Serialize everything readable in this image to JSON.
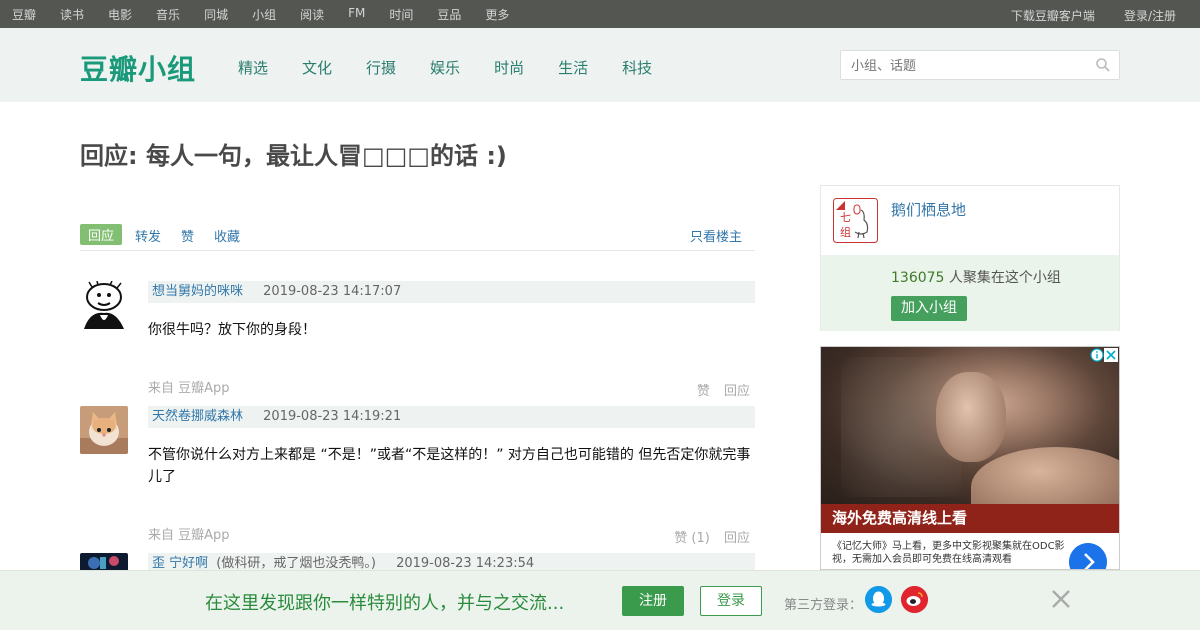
{
  "global_nav": {
    "links": [
      "豆瓣",
      "读书",
      "电影",
      "音乐",
      "同城",
      "小组",
      "阅读",
      "FM",
      "时间",
      "豆品",
      "更多"
    ],
    "download": "下载豆瓣客户端",
    "login": "登录/注册"
  },
  "group_header": {
    "logo": "豆瓣小组",
    "categories": [
      "精选",
      "文化",
      "行摄",
      "娱乐",
      "时尚",
      "生活",
      "科技"
    ],
    "search_placeholder": "小组、话题"
  },
  "topic": {
    "title": "回应: 每人一句，最让人冒□□□的话 :)"
  },
  "actions": {
    "reply": "回应",
    "forward": "转发",
    "like": "赞",
    "collect": "收藏",
    "only_op": "只看楼主"
  },
  "comments": [
    {
      "author": "想当舅妈的咪咪",
      "time": "2019-08-23 14:17:07",
      "content": "你很牛吗？放下你的身段！",
      "source": "来自 豆瓣App",
      "like": "赞",
      "reply": "回应"
    },
    {
      "author": "天然卷挪威森林",
      "time": "2019-08-23 14:19:21",
      "content": "不管你说什么对方上来都是 “不是！”或者“不是这样的！” 对方自己也可能错的 但先否定你就完事儿了",
      "source": "来自 豆瓣App",
      "like": "赞 (1)",
      "reply": "回应"
    },
    {
      "author": "歪  宁好啊",
      "signature": "(做科研，戒了烟也没秃鸭。)",
      "time": "2019-08-23 14:23:54"
    }
  ],
  "group_card": {
    "name": "鹅们栖息地",
    "member_count": "136075",
    "member_suffix": " 人聚集在这个小组",
    "join": "加入小组",
    "icon_text": "七组"
  },
  "ad": {
    "banner": "海外免费高清线上看",
    "description": "《记忆大师》马上看，更多中文影视聚集就在ODC影视，无需加入会员即可免费在线高清观看"
  },
  "bottom_bar": {
    "message": "在这里发现跟你一样特别的人，并与之交流...",
    "register": "注册",
    "login": "登录",
    "third_party": "第三方登录："
  }
}
